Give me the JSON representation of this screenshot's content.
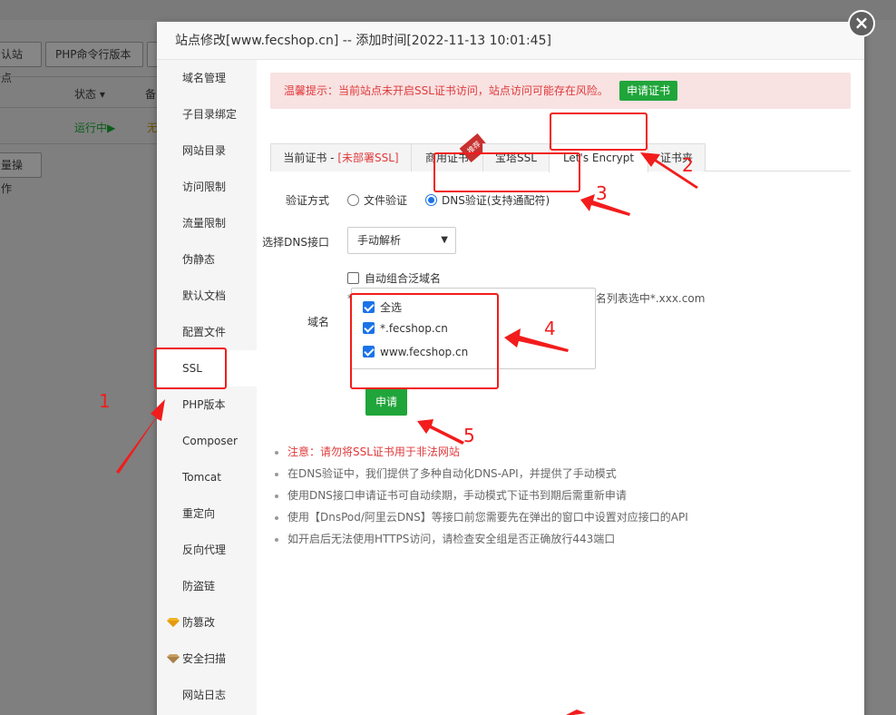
{
  "background": {
    "buttons": [
      "认站点",
      "PHP命令行版本"
    ],
    "columns": [
      "状态",
      "备"
    ],
    "row_status": "运行中",
    "row_extra": "无",
    "batch_label": "量操作"
  },
  "modal": {
    "title": "站点修改[www.fecshop.cn] -- 添加时间[2022-11-13 10:01:45]",
    "close_symbol": "×"
  },
  "sidebar": {
    "items": [
      {
        "label": "域名管理"
      },
      {
        "label": "子目录绑定"
      },
      {
        "label": "网站目录"
      },
      {
        "label": "访问限制"
      },
      {
        "label": "流量限制"
      },
      {
        "label": "伪静态"
      },
      {
        "label": "默认文档"
      },
      {
        "label": "配置文件"
      },
      {
        "label": "SSL"
      },
      {
        "label": "PHP版本"
      },
      {
        "label": "Composer"
      },
      {
        "label": "Tomcat"
      },
      {
        "label": "重定向"
      },
      {
        "label": "反向代理"
      },
      {
        "label": "防盗链"
      },
      {
        "label": "防篡改",
        "icon": "diamond-icon"
      },
      {
        "label": "安全扫描",
        "icon": "diamond-icon"
      },
      {
        "label": "网站日志"
      }
    ]
  },
  "alert": {
    "text": "温馨提示：当前站点未开启SSL证书访问，站点访问可能存在风险。",
    "button": "申请证书"
  },
  "tabs": {
    "current_prefix": "当前证书 - ",
    "current_status": "[未部署SSL]",
    "commercial": "商用证书",
    "ribbon": "推荐",
    "baota": "宝塔SSL",
    "letsencrypt": "Let's Encrypt",
    "folder": "证书夹"
  },
  "form": {
    "verify_label": "验证方式",
    "verify_file": "文件验证",
    "verify_dns": "DNS验证(支持通配符)",
    "dns_label": "选择DNS接口",
    "dns_selected": "手动解析",
    "auto_wildcard": "自动组合泛域名",
    "wildcard_note": "* 如需申请通配符域名请勾选此项目且不要在下方域名列表选中*.xxx.com",
    "domain_label": "域名",
    "domains": [
      "全选",
      "*.fecshop.cn",
      "www.fecshop.cn"
    ],
    "apply": "申请"
  },
  "tips": [
    "注意：请勿将SSL证书用于非法网站",
    "在DNS验证中，我们提供了多种自动化DNS-API，并提供了手动模式",
    "使用DNS接口申请证书可自动续期，手动模式下证书到期后需重新申请",
    "使用【DnsPod/阿里云DNS】等接口前您需要先在弹出的窗口中设置对应接口的API",
    "如开启后无法使用HTTPS访问，请检查安全组是否正确放行443端口"
  ],
  "annotations": [
    "1",
    "2",
    "3",
    "4",
    "5"
  ],
  "colors": {
    "annotation_red": "#f21c1c",
    "primary_green": "#20a53a",
    "alert_red": "#e0393b"
  }
}
